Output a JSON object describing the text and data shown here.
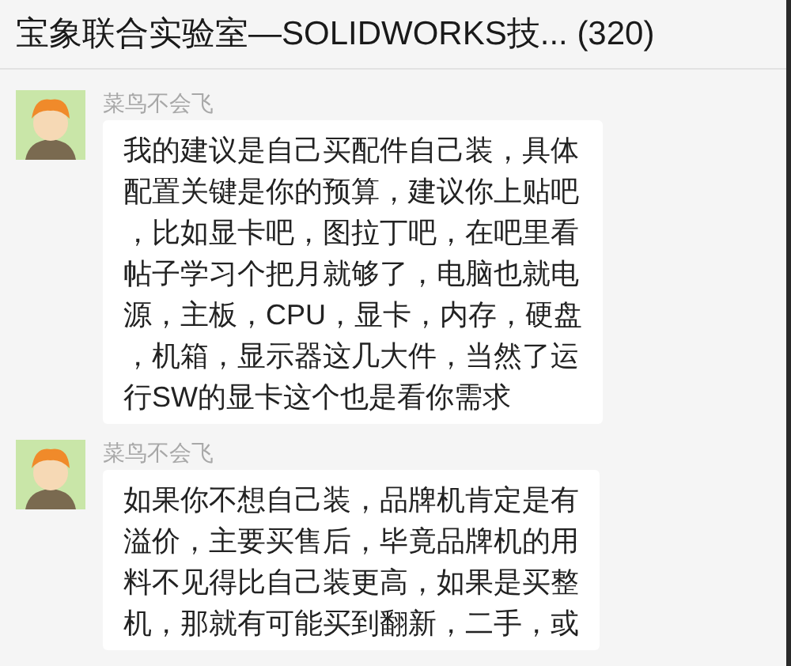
{
  "window": {
    "title": "宝象联合实验室—SOLIDWORKS技... (320)"
  },
  "messages": [
    {
      "sender": "菜鸟不会飞",
      "lines": [
        "我的建议是自己买配件自己装，具体",
        "配置关键是你的预算，建议你上贴吧",
        "，比如显卡吧，图拉丁吧，在吧里看",
        "帖子学习个把月就够了，电脑也就电",
        "源，主板，CPU，显卡，内存，硬盘",
        "，机箱，显示器这几大件，当然了运",
        "行SW的显卡这个也是看你需求"
      ]
    },
    {
      "sender": "菜鸟不会飞",
      "lines": [
        "如果你不想自己装，品牌机肯定是有",
        "溢价，主要买售后，毕竟品牌机的用",
        "料不见得比自己装更高，如果是买整",
        "机，那就有可能买到翻新，二手，或"
      ]
    }
  ]
}
